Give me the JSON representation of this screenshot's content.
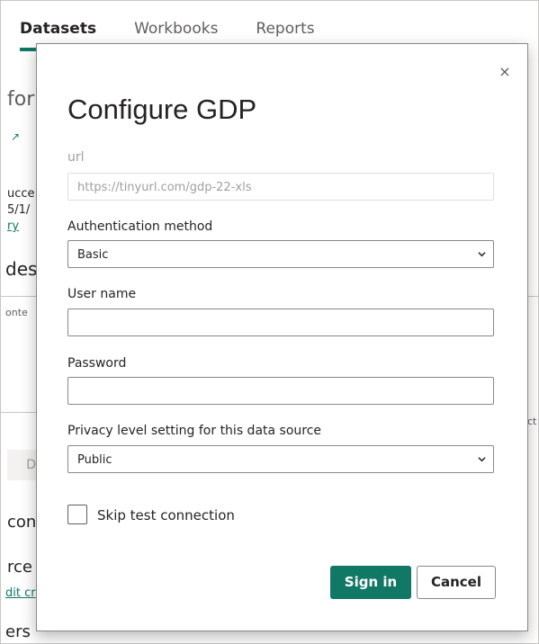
{
  "tabs": [
    "Datasets",
    "Workbooks",
    "Reports"
  ],
  "background_fragments": {
    "heading1": "for",
    "line1": "ucce",
    "line2": "5/1/",
    "link1": "ry",
    "heading2": "desc",
    "small1": "onte",
    "tab_btn": "D",
    "right_frag": "ct",
    "heading3": "con",
    "heading4": "rce",
    "link2": "dit cr",
    "heading5": "ers"
  },
  "modal": {
    "title": "Configure GDP",
    "url": {
      "label": "url",
      "value": "https://tinyurl.com/gdp-22-xls"
    },
    "auth": {
      "label": "Authentication method",
      "value": "Basic"
    },
    "username": {
      "label": "User name",
      "value": ""
    },
    "password": {
      "label": "Password",
      "value": ""
    },
    "privacy": {
      "label": "Privacy level setting for this data source",
      "value": "Public"
    },
    "skip_test": {
      "label": "Skip test connection",
      "checked": false
    },
    "buttons": {
      "sign_in": "Sign in",
      "cancel": "Cancel"
    },
    "close_glyph": "×"
  },
  "colors": {
    "accent": "#117865",
    "border": "#8a8886",
    "disabled_text": "#a19f9d"
  }
}
